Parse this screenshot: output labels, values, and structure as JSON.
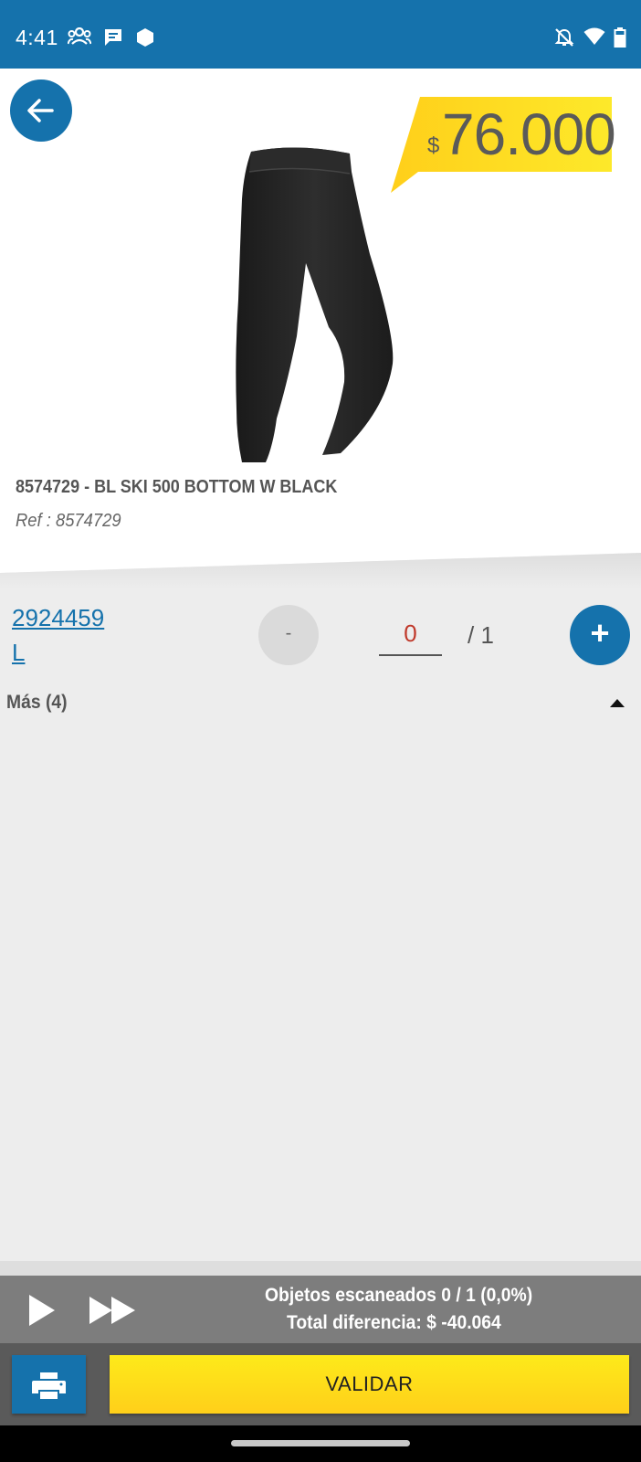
{
  "status_bar": {
    "time": "4:41",
    "icons_left": [
      "group-icon",
      "message-icon",
      "hexagon-icon"
    ],
    "icons_right": [
      "notifications-off-icon",
      "wifi-icon",
      "battery-icon"
    ]
  },
  "product": {
    "price_currency": "$",
    "price": "76.000",
    "title": "8574729 - BL SKI 500 BOTTOM W BLACK",
    "ref": "Ref : 8574729",
    "image": "black-leggings-image"
  },
  "item": {
    "code": "2924459",
    "size": "L",
    "minus_label": "-",
    "quantity": "0",
    "quantity_total": "/ 1",
    "plus_label": "+"
  },
  "more": {
    "label": "Más (4)"
  },
  "summary": {
    "scanned": "Objetos escaneados 0 / 1 (0,0%)",
    "difference": "Total diferencia:  $ -40.064"
  },
  "actions": {
    "validate_label": "VALIDAR"
  },
  "colors": {
    "primary_blue": "#1572ac",
    "price_yellow": "#ffd41a",
    "quantity_red": "#c0392b"
  }
}
